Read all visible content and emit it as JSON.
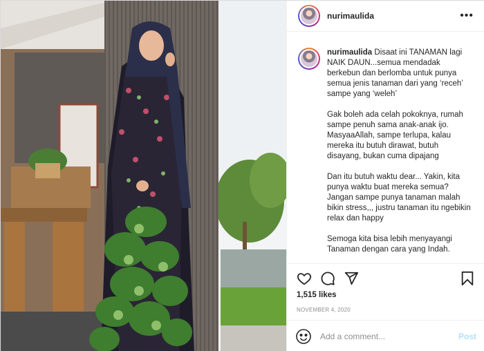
{
  "post": {
    "username": "nurimaulida",
    "more_icon": "more-dots-icon",
    "caption": {
      "username": "nurimaulida",
      "para1": "Disaat ini TANAMAN lagi NAIK DAUN...semua mendadak berkebun dan berlomba untuk punya semua jenis tanaman dari yang ‘receh’ sampe yang ‘weleh’",
      "para2": "Gak boleh ada celah pokoknya, rumah sampe penuh sama anak-anak ijo. MasyaaAllah, sampe terlupa, kalau mereka itu butuh dirawat, butuh disayang, bukan cuma dipajang",
      "para3": "Dan itu butuh waktu dear... Yakin, kita punya waktu buat mereka semua? Jangan sampe punya tanaman malah bikin stress,,, justru tanaman itu ngebikin relax dan happy",
      "para4": "Semoga kita bisa lebih menyayangi Tanaman dengan cara yang Indah."
    },
    "likes": "1,515 likes",
    "date": "NOVEMBER 4, 2020",
    "comment_placeholder": "Add a comment...",
    "post_label": "Post"
  },
  "icons": [
    "heart-icon",
    "comment-icon",
    "share-icon",
    "bookmark-icon",
    "emoji-icon"
  ],
  "colors": {
    "post_button": "#b2dffc",
    "meta_gray": "#8e8e8e",
    "text": "#262626"
  }
}
